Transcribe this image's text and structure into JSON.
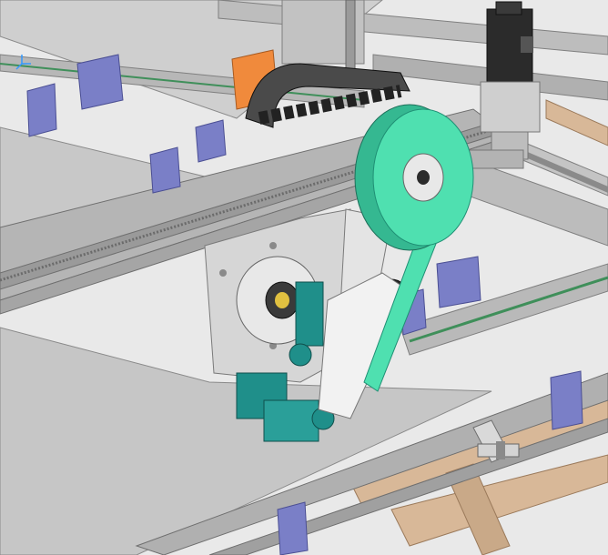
{
  "viewport": {
    "label": "",
    "background": "#e9e9e9"
  },
  "colors": {
    "plate": "#c9c9c9",
    "plate_edge": "#8a8a8a",
    "rail": "#b7b7b7",
    "rail_dark": "#7f7f7f",
    "rack": "#9a9a9a",
    "belt": "#4fe0b0",
    "belt_dark": "#1f8f74",
    "pulley": "#46d6a6",
    "bracket_blue": "#7a7fc7",
    "bracket_blue_dark": "#4b4f93",
    "teal_parts": "#1f8f8a",
    "motor": "#2b2b2b",
    "wood": "#d8b898",
    "chain": "#3b3b3b",
    "orange": "#f08a3c",
    "green_strip": "#3f8f5a"
  },
  "icons": {
    "origin_triad": "axis-triad-icon"
  }
}
